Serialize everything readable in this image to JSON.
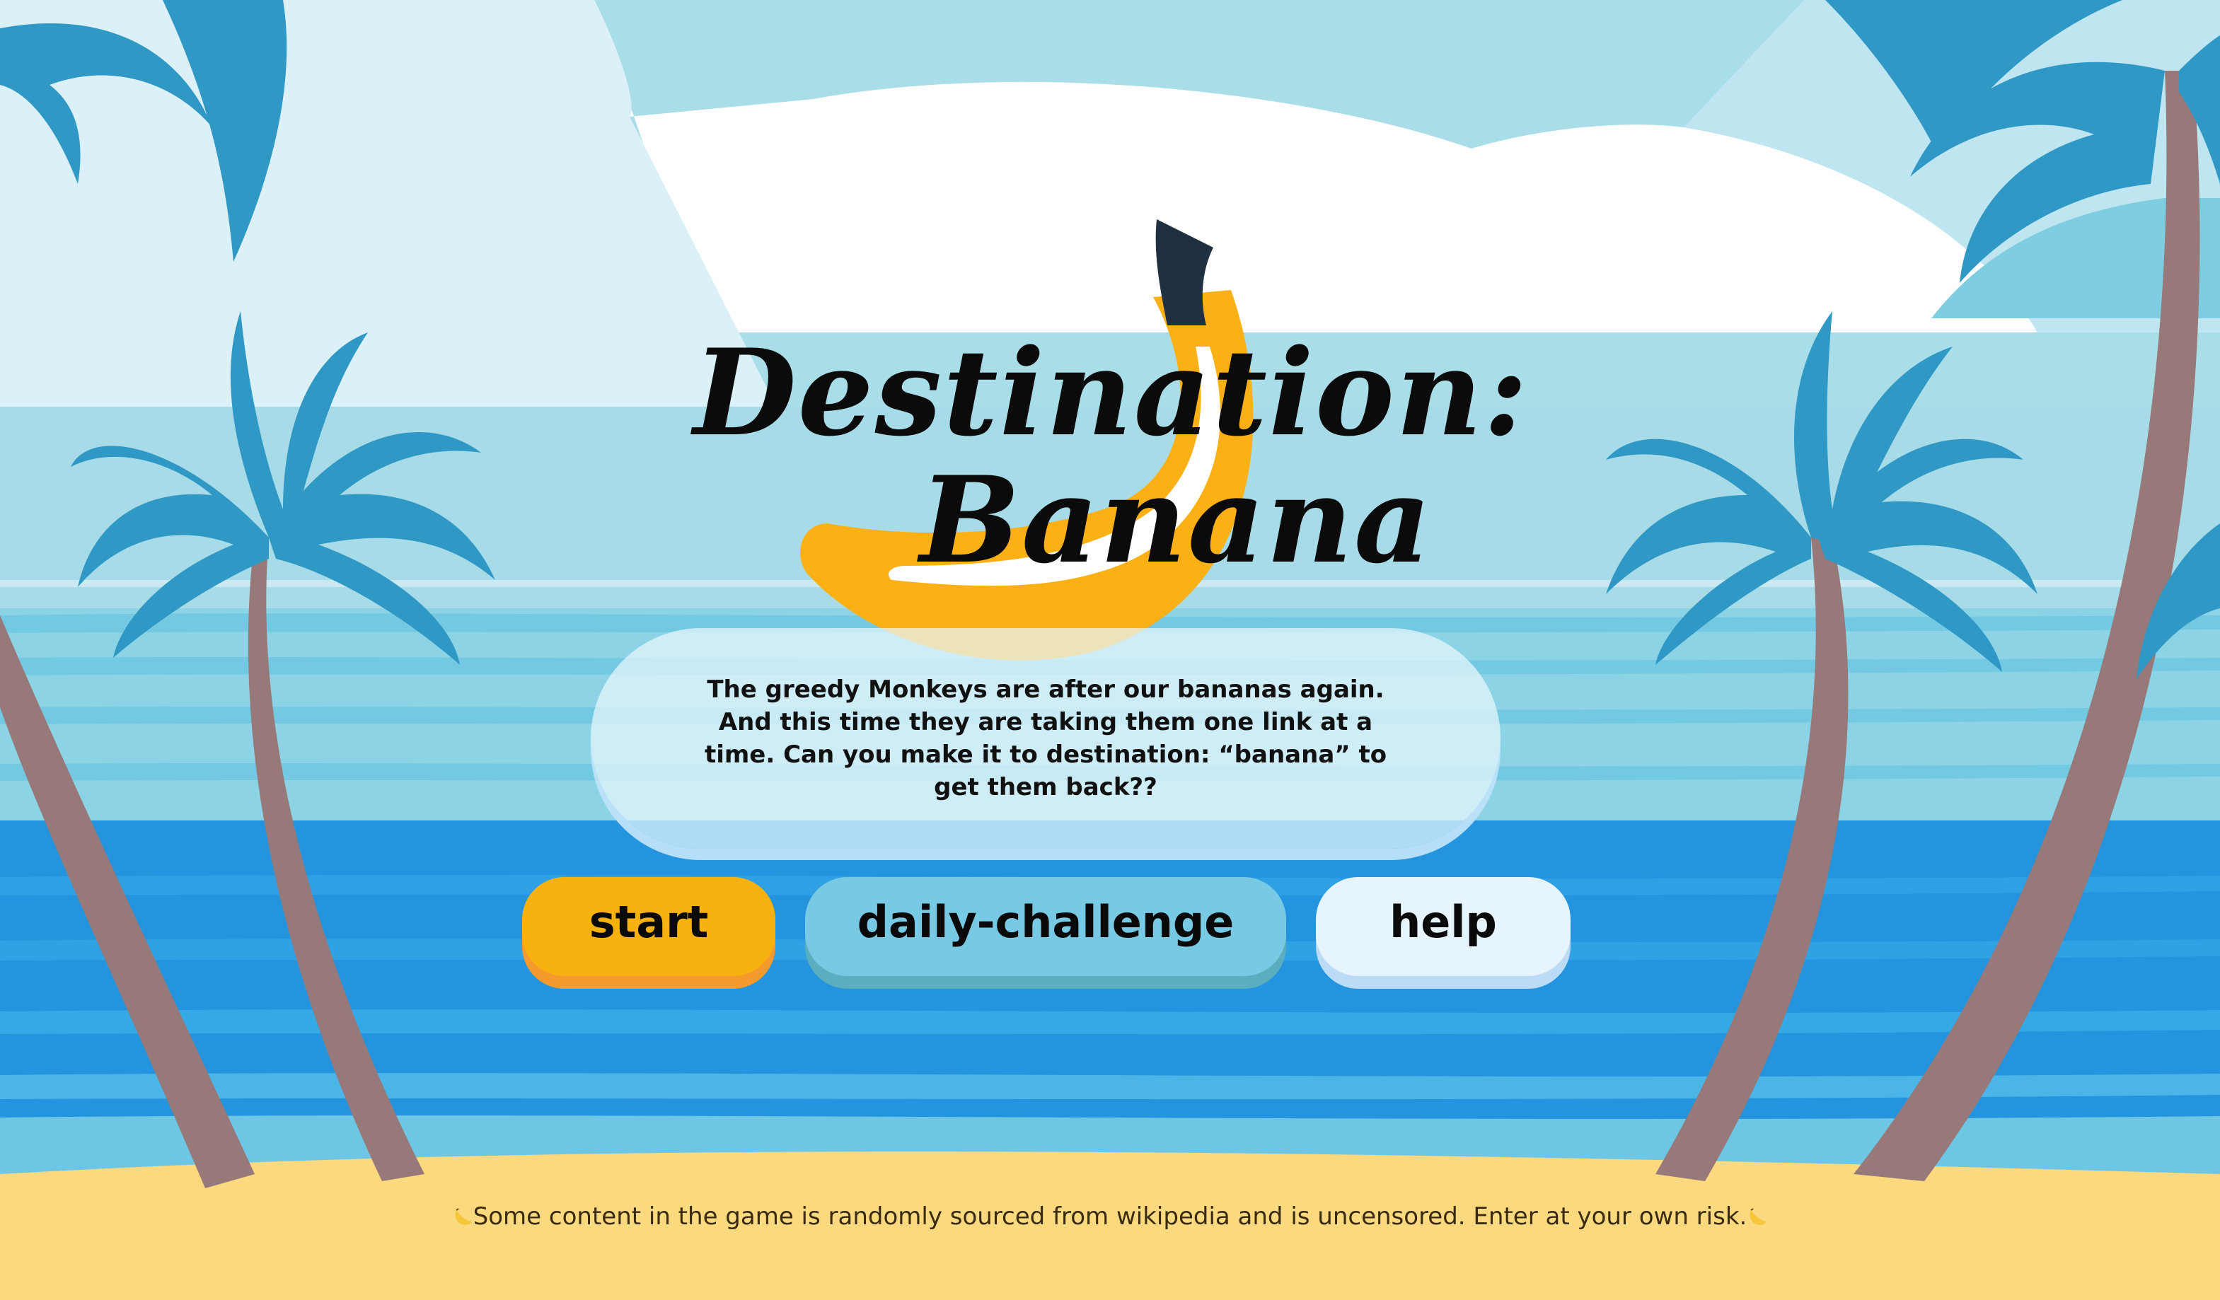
{
  "title": {
    "line1": "Destination:",
    "line2": "Banana"
  },
  "intro": {
    "text": "The greedy Monkeys are after our bananas again. And this time they are taking them one link at a time. Can you make it to destination: “banana” to get them back??"
  },
  "buttons": {
    "start": "start",
    "daily_challenge": "daily-challenge",
    "help": "help"
  },
  "footer": {
    "disclaimer": "Some content in the game is randomly sourced from wikipedia and is uncensored. Enter at your own risk."
  },
  "icons": {
    "banana_logo": "banana-icon",
    "disclaimer_left": "banana-icon",
    "disclaimer_right": "banana-icon"
  },
  "colors": {
    "sky": "#a9dde8",
    "sea": "#2394dd",
    "sand": "#fbd97f",
    "palm_leaf": "#2f98c5",
    "palm_trunk": "#977979",
    "banana": "#fbb015",
    "start_button": "#f8b20f",
    "daily_button": "#78c9e3",
    "help_button": "#e6f4fd"
  }
}
